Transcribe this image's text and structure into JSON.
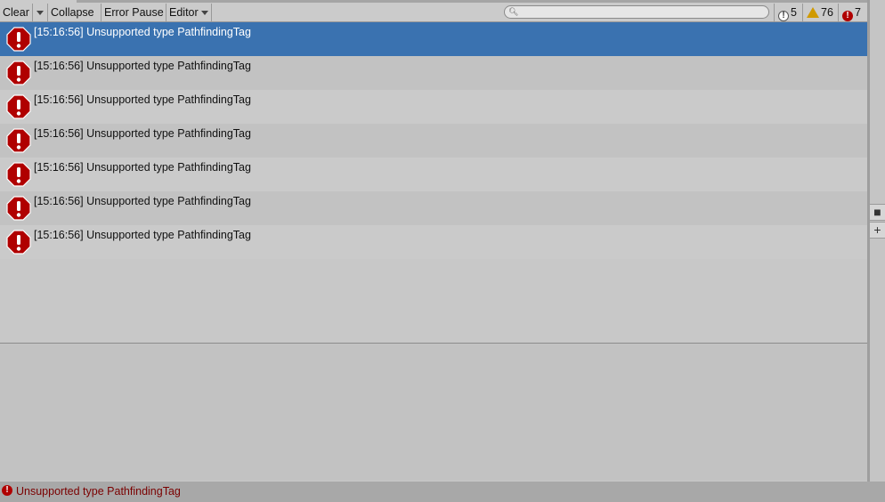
{
  "toolbar": {
    "clear_label": "Clear",
    "collapse_label": "Collapse",
    "error_pause_label": "Error Pause",
    "editor_label": "Editor",
    "search_placeholder": "",
    "info_count": "5",
    "warning_count": "76",
    "error_count": "7"
  },
  "colors": {
    "selection": "#3a72b0",
    "error_red": "#b00000",
    "warning_yellow": "#d09a00"
  },
  "log_entries": [
    {
      "text": "[15:16:56] Unsupported type PathfindingTag",
      "type": "error",
      "selected": true
    },
    {
      "text": "[15:16:56] Unsupported type PathfindingTag",
      "type": "error",
      "selected": false
    },
    {
      "text": "[15:16:56] Unsupported type PathfindingTag",
      "type": "error",
      "selected": false
    },
    {
      "text": "[15:16:56] Unsupported type PathfindingTag",
      "type": "error",
      "selected": false
    },
    {
      "text": "[15:16:56] Unsupported type PathfindingTag",
      "type": "error",
      "selected": false
    },
    {
      "text": "[15:16:56] Unsupported type PathfindingTag",
      "type": "error",
      "selected": false
    },
    {
      "text": "[15:16:56] Unsupported type PathfindingTag",
      "type": "error",
      "selected": false
    }
  ],
  "status": {
    "text": "Unsupported type PathfindingTag",
    "icon": "error-icon"
  }
}
